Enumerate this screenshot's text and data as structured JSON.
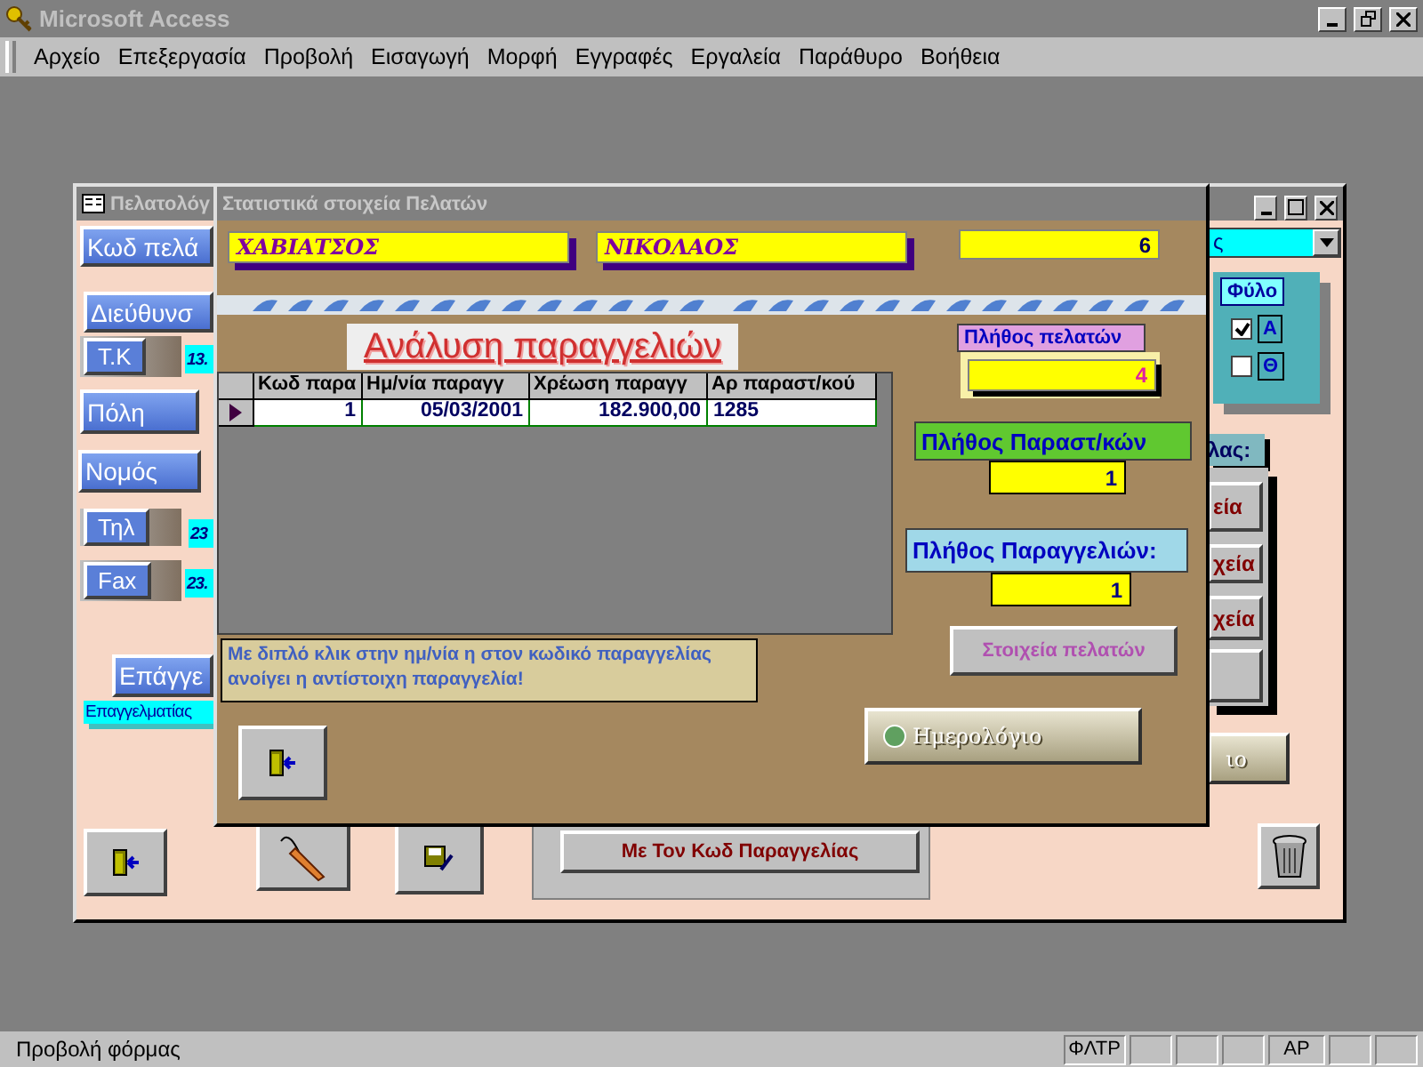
{
  "app": {
    "title": "Microsoft Access"
  },
  "menu": [
    "Αρχείο",
    "Επεξεργασία",
    "Προβολή",
    "Εισαγωγή",
    "Μορφή",
    "Εγγραφές",
    "Εργαλεία",
    "Παράθυρο",
    "Βοήθεια"
  ],
  "customer_form": {
    "title": "Πελατολόγ",
    "left_controls": [
      {
        "kind": "label",
        "text": "Κωδ πελά"
      },
      {
        "kind": "label",
        "text": "Διεύθυνσ"
      },
      {
        "kind": "tag",
        "text": "Τ.Κ"
      },
      {
        "kind": "value",
        "text": "13."
      },
      {
        "kind": "label",
        "text": "Πόλη"
      },
      {
        "kind": "label",
        "text": "Νομός"
      },
      {
        "kind": "tag",
        "text": "Τηλ"
      },
      {
        "kind": "value",
        "text": "23"
      },
      {
        "kind": "tag",
        "text": "Fax"
      },
      {
        "kind": "value",
        "text": "23."
      },
      {
        "kind": "label",
        "text": "Επάγγε"
      },
      {
        "kind": "note",
        "text": "Επαγγελματίας"
      }
    ],
    "combo": {
      "value": "ς"
    },
    "gender": {
      "title": "Φύλο",
      "options": [
        {
          "label": "Α",
          "checked": true
        },
        {
          "label": "Θ",
          "checked": false
        }
      ]
    },
    "side_label": "λας:",
    "side_buttons": [
      "εία",
      "χεία",
      "χεία"
    ],
    "calendar_button": "ιο",
    "order_button": "Με Τον Κωδ Παραγγελίας"
  },
  "stats_dialog": {
    "title": "Στατιστικά στοιχεία Πελατών",
    "surname": "ΧΑΒΙΑΤΣΟΣ",
    "first_name": "ΝΙΚΟΛΑΟΣ",
    "customer_code": "6",
    "heading": "Ανάλυση παραγγελιών",
    "table": {
      "columns": [
        "Κωδ παρα",
        "Ημ/νία παραγγ",
        "Χρέωση παραγγ",
        "Αρ παραστ/κού"
      ],
      "rows": [
        {
          "current": true,
          "cells": [
            "1",
            "05/03/2001",
            "182.900,00",
            "1285"
          ]
        }
      ]
    },
    "note": "Με διπλό κλικ στην ημ/νία η στον κωδικό παραγγελίας ανοίγει η αντίστοιχη παραγγελία!",
    "stats": [
      {
        "kind": "pink",
        "label": "Πλήθος πελατών",
        "value": "4"
      },
      {
        "kind": "green",
        "label": "Πλήθος Παραστ/κών",
        "value": "1"
      },
      {
        "kind": "blue",
        "label": "Πλήθος Παραγγελιών:",
        "value": "1"
      }
    ],
    "details_button": "Στοιχεία πελατών",
    "calendar_button": "Ημερολόγιο"
  },
  "status_bar": {
    "text": "Προβολή φόρμας",
    "indicators": [
      {
        "on": true,
        "text": "ΦΛΤΡ"
      },
      {
        "on": false
      },
      {
        "on": false
      },
      {
        "on": false
      },
      {
        "on": true,
        "text": "ΑΡ"
      },
      {
        "on": false
      },
      {
        "on": false
      }
    ]
  }
}
